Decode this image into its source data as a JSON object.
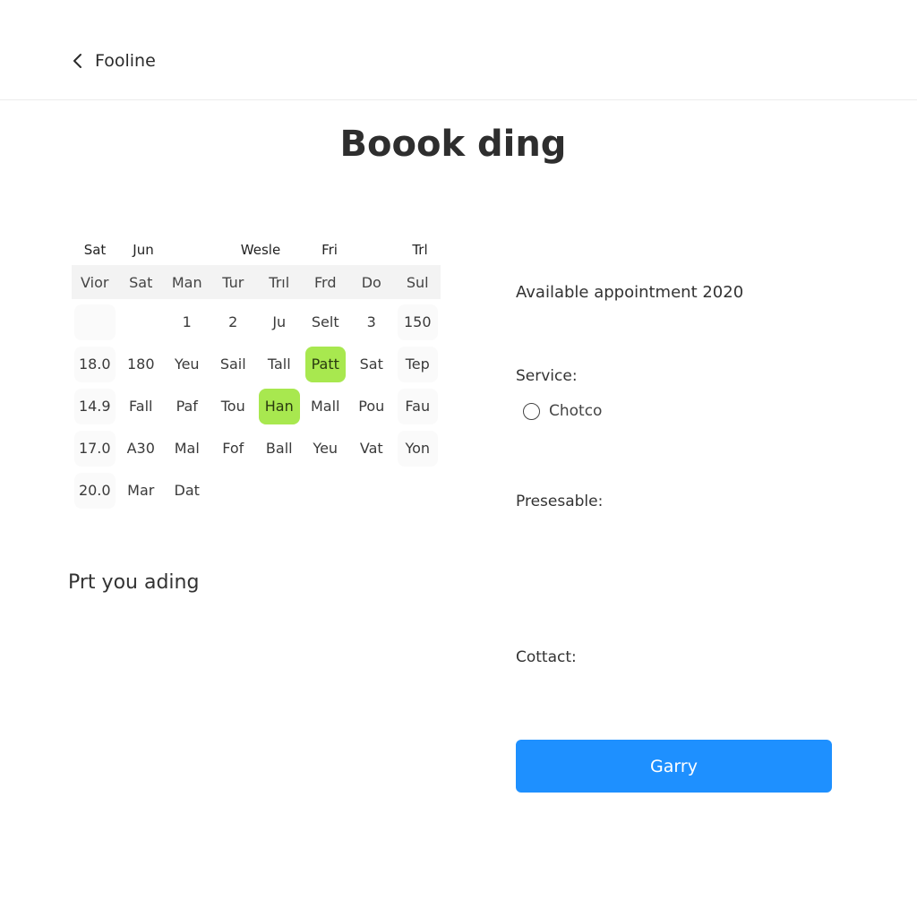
{
  "header": {
    "back_label": "Fooline"
  },
  "page": {
    "title": "Boook ding"
  },
  "calendar": {
    "header_labels": [
      "Sat",
      "Jun",
      "",
      "Wesle",
      "Fri",
      "",
      "Trl"
    ],
    "day_labels": [
      "Vior",
      "Sat",
      "Man",
      "Tur",
      "Trıl",
      "Frd",
      "Do",
      "Sul"
    ],
    "rows": [
      [
        "",
        "",
        "1",
        "2",
        "Ju",
        "Selt",
        "3",
        "150"
      ],
      [
        "18.0",
        "180",
        "Yeu",
        "Sail",
        "Tall",
        "Patt",
        "Sat",
        "Tep"
      ],
      [
        "14.9",
        "Fall",
        "Paf",
        "Tou",
        "Han",
        "Mall",
        "Pou",
        "Fau"
      ],
      [
        "17.0",
        "A30",
        "Mal",
        "Fof",
        "Ball",
        "Yeu",
        "Vat",
        "Yon"
      ],
      [
        "20.0",
        "Mar",
        "Dat",
        "",
        "",
        "",
        "",
        ""
      ]
    ],
    "selected": [
      [
        1,
        5
      ],
      [
        2,
        4
      ]
    ],
    "selected_color": "#a8e84f"
  },
  "left_note": "Prt you ading",
  "form": {
    "available_label": "Available appointment 2020",
    "service_label": "Service:",
    "service_option": "Chotco",
    "presesable_label": "Presesable:",
    "contact_label": "Cottact:",
    "submit_label": "Garry",
    "submit_color": "#1e90ff"
  }
}
